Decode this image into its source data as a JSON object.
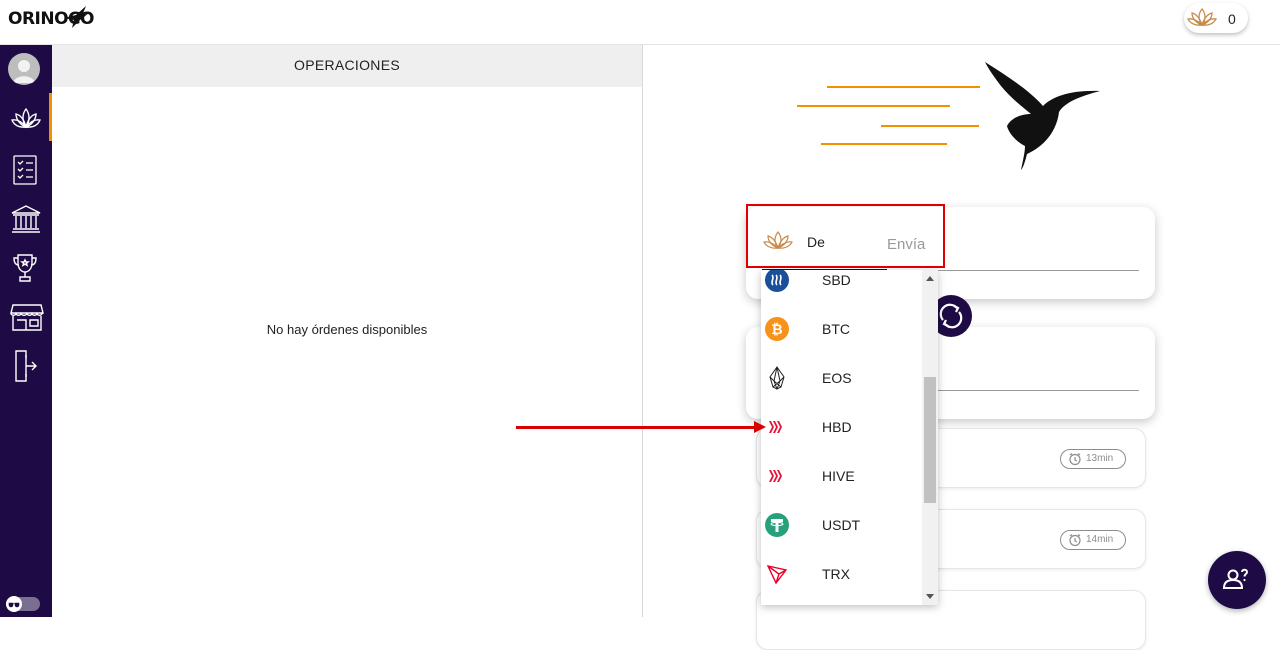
{
  "header": {
    "logo_text": "ORINOCO",
    "balance_value": "0"
  },
  "sidebar": {
    "items": [
      {
        "icon": "lotus-icon"
      },
      {
        "icon": "checklist-icon"
      },
      {
        "icon": "bank-icon"
      },
      {
        "icon": "trophy-icon"
      },
      {
        "icon": "store-icon"
      },
      {
        "icon": "logout-icon"
      }
    ]
  },
  "operations": {
    "title": "OPERACIONES",
    "empty_message": "No hay órdenes disponibles"
  },
  "exchange": {
    "from_label": "De",
    "send_placeholder": "Envía"
  },
  "dropdown": {
    "options": [
      {
        "label": "SBD",
        "icon": "steem-icon",
        "color": "#1a5099"
      },
      {
        "label": "BTC",
        "icon": "bitcoin-icon",
        "color": "#f7931a"
      },
      {
        "label": "EOS",
        "icon": "eos-icon",
        "color": "#222222"
      },
      {
        "label": "HBD",
        "icon": "hive-icon",
        "color": "#e31337"
      },
      {
        "label": "HIVE",
        "icon": "hive-icon",
        "color": "#e31337"
      },
      {
        "label": "USDT",
        "icon": "tether-icon",
        "color": "#26a17b"
      },
      {
        "label": "TRX",
        "icon": "tron-icon",
        "color": "#eb0029"
      }
    ]
  },
  "orders": [
    {
      "time": "13min"
    },
    {
      "time": "14min"
    }
  ],
  "colors": {
    "brand_dark": "#1e0b45",
    "accent": "#f29100",
    "highlight": "#e00000"
  }
}
